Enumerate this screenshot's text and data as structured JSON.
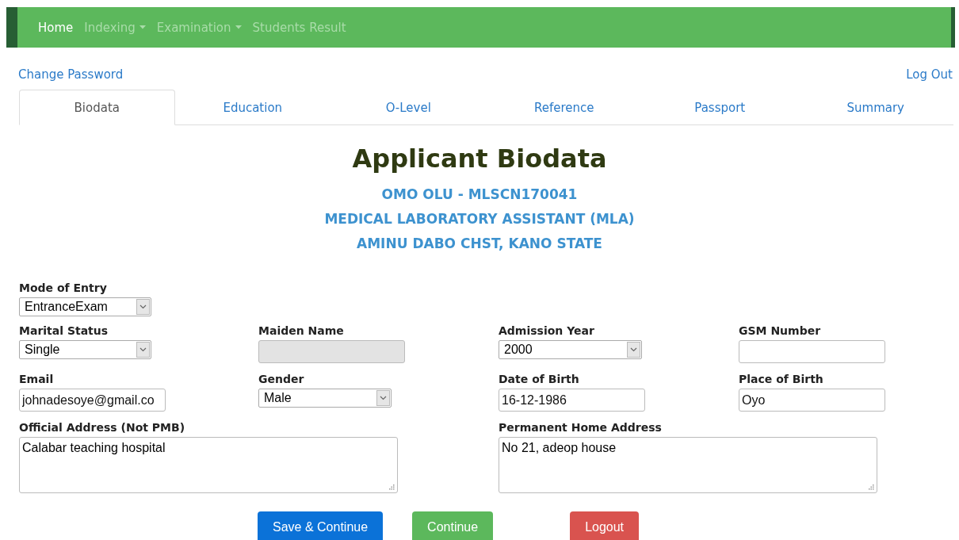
{
  "nav": {
    "items": [
      {
        "label": "Home",
        "selected": true,
        "dropdown": false
      },
      {
        "label": "Indexing",
        "selected": false,
        "dropdown": true
      },
      {
        "label": "Examination",
        "selected": false,
        "dropdown": true
      },
      {
        "label": "Students Result",
        "selected": false,
        "dropdown": false
      }
    ]
  },
  "account_links": {
    "change_password": "Change Password",
    "log_out": "Log Out"
  },
  "tabs": [
    {
      "label": "Biodata",
      "selected": true
    },
    {
      "label": "Education",
      "selected": false
    },
    {
      "label": "O-Level",
      "selected": false
    },
    {
      "label": "Reference",
      "selected": false
    },
    {
      "label": "Passport",
      "selected": false
    },
    {
      "label": "Summary",
      "selected": false
    }
  ],
  "heading": {
    "title": "Applicant Biodata",
    "lines": [
      "OMO OLU - MLSCN170041",
      "MEDICAL LABORATORY ASSISTANT (MLA)",
      "AMINU DABO CHST, KANO STATE"
    ]
  },
  "form_rows": [
    [
      {
        "label": "Mode of Entry",
        "kind": "select",
        "value": "EntranceExam"
      }
    ],
    [
      {
        "label": "Marital Status",
        "kind": "select",
        "value": "Single"
      },
      {
        "label": "Maiden Name",
        "kind": "text",
        "disabled": true
      },
      {
        "label": "Admission Year",
        "kind": "select",
        "value": "2000"
      },
      {
        "label": "GSM Number",
        "kind": "text",
        "disabled": false
      }
    ],
    [
      {
        "label": "Email",
        "kind": "text",
        "value": "johnadesoye@gmail.co",
        "disabled": false
      },
      {
        "label": "Gender",
        "kind": "select",
        "value": "Male"
      },
      {
        "label": "Date of Birth",
        "kind": "text",
        "value": "16-12-1986",
        "disabled": false
      },
      {
        "label": "Place of Birth",
        "kind": "text",
        "value": "Oyo",
        "disabled": false
      }
    ],
    [
      {
        "label": "Official Address (Not PMB)",
        "kind": "textarea",
        "value": "Calabar teaching hospital"
      },
      {
        "label": "Permanent Home Address",
        "kind": "textarea",
        "value": "No 21, adeop house"
      }
    ]
  ],
  "buttons": [
    {
      "label": "Save & Continue",
      "kind": "primary"
    },
    {
      "label": "Continue",
      "kind": "success"
    },
    {
      "label": "Logout",
      "kind": "danger"
    }
  ]
}
